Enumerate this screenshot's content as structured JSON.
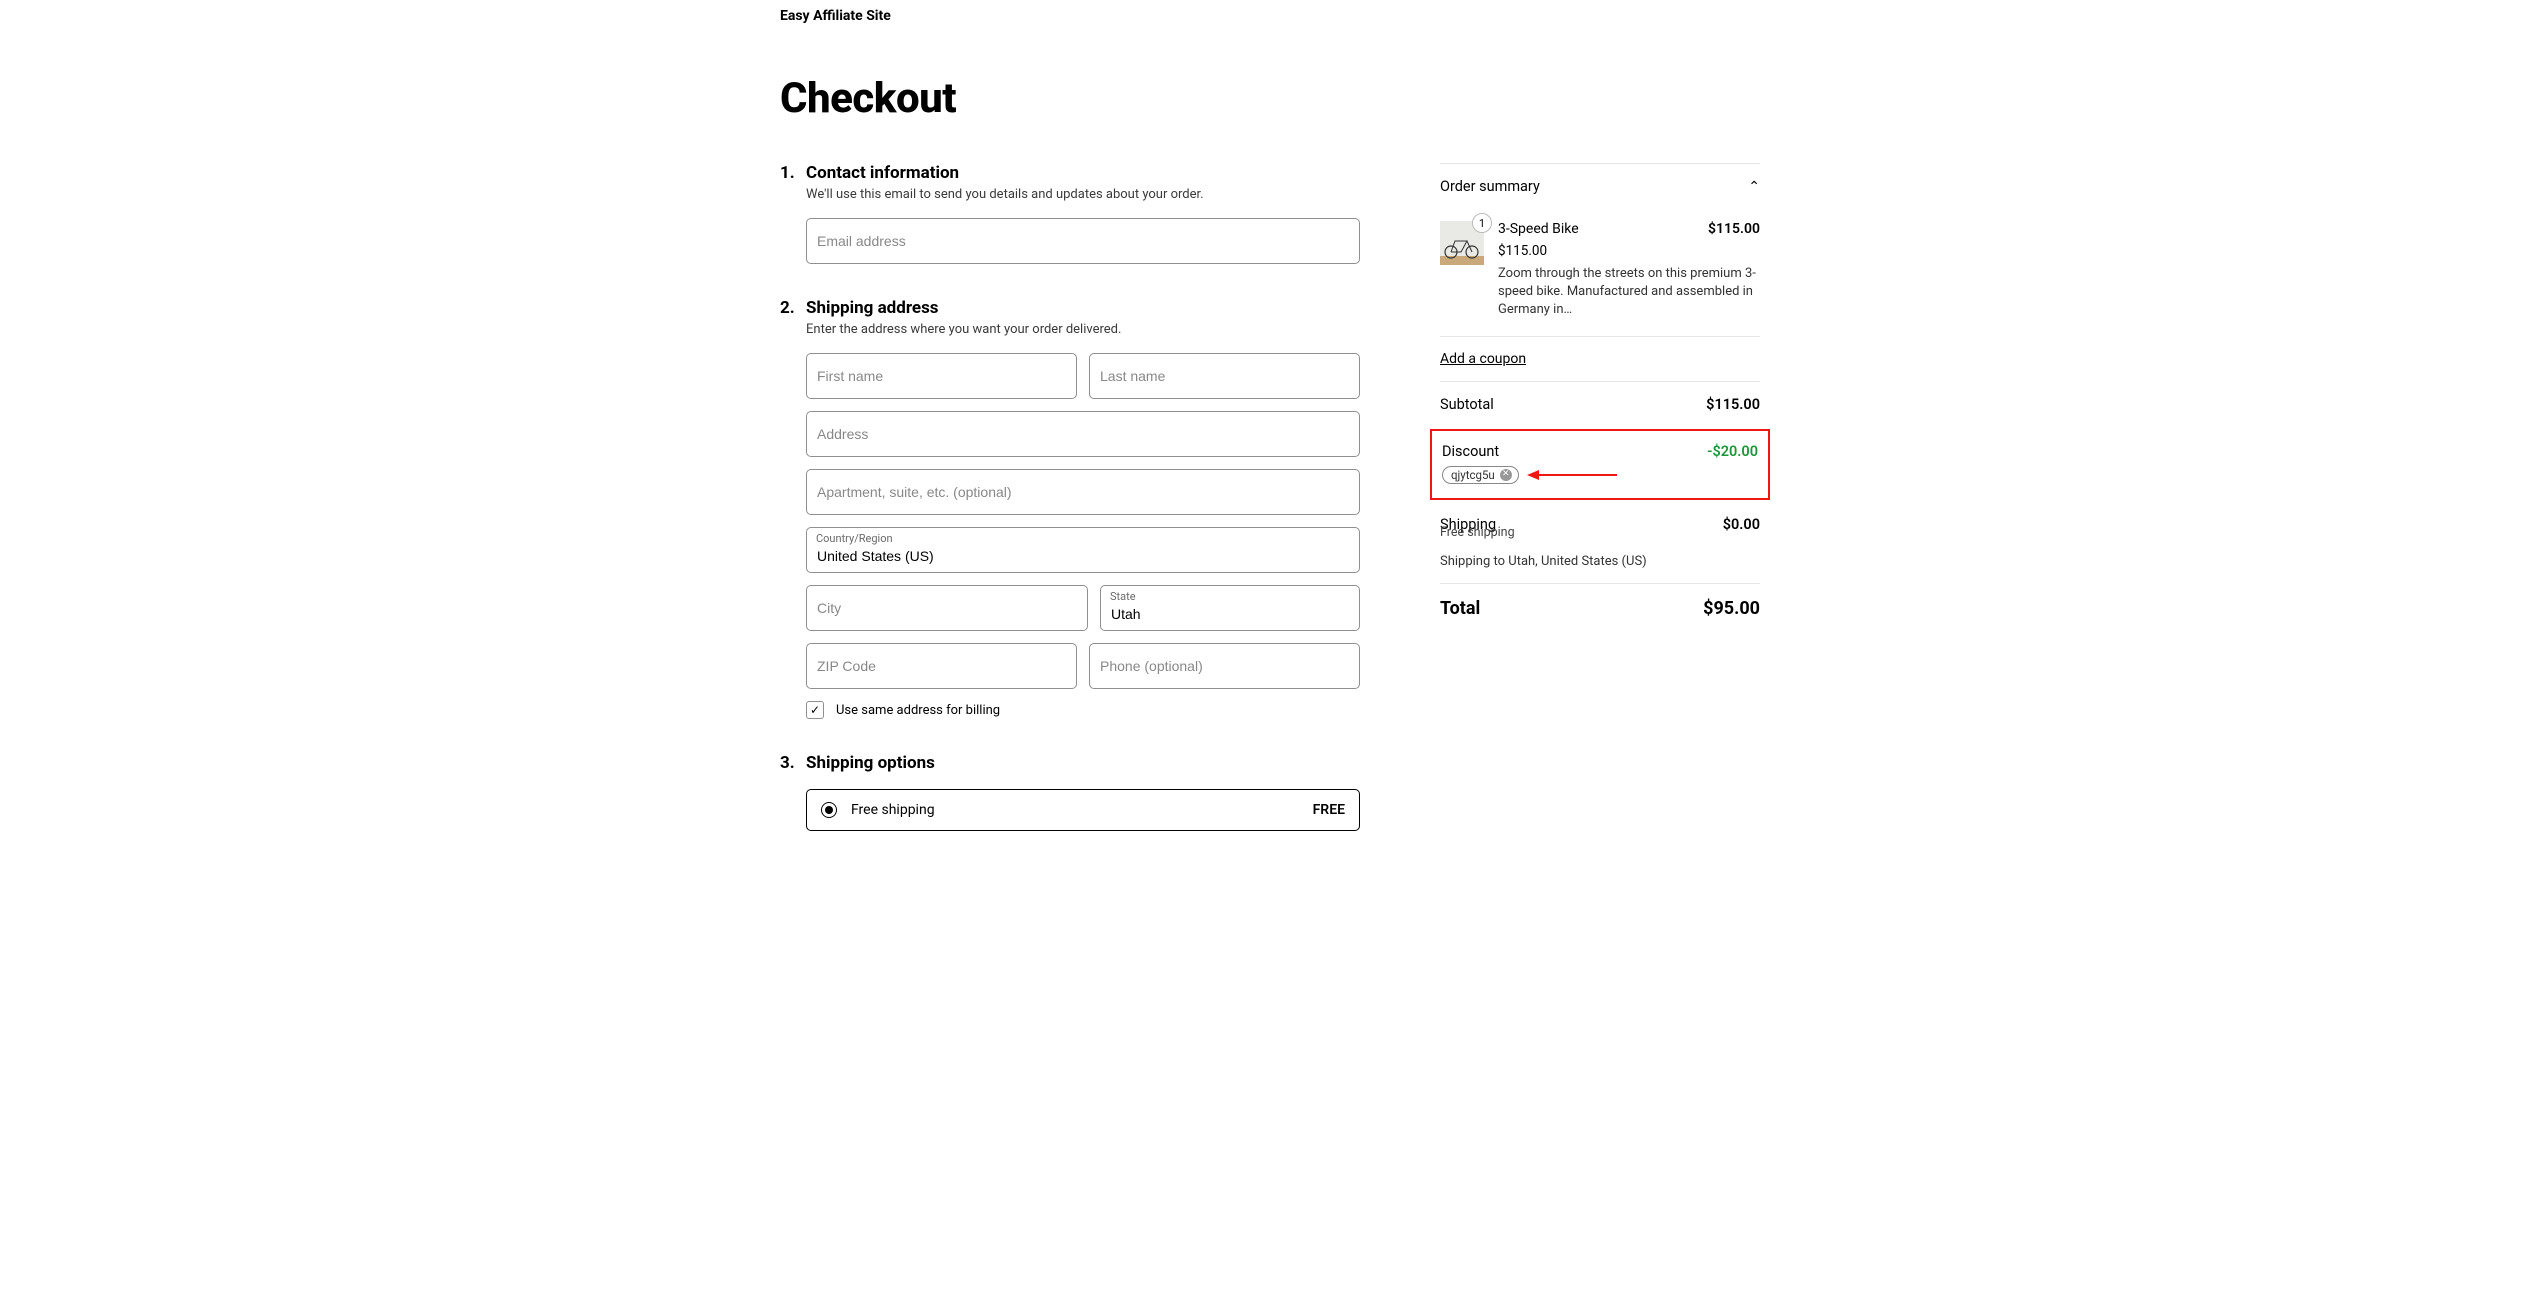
{
  "site_title": "Easy Affiliate Site",
  "page_title": "Checkout",
  "contact": {
    "step": "1.",
    "heading": "Contact information",
    "help": "We'll use this email to send you details and updates about your order.",
    "email_placeholder": "Email address",
    "email_value": ""
  },
  "shipping": {
    "step": "2.",
    "heading": "Shipping address",
    "help": "Enter the address where you want your order delivered.",
    "first_name_placeholder": "First name",
    "first_name_value": "",
    "last_name_placeholder": "Last name",
    "last_name_value": "",
    "address_placeholder": "Address",
    "address_value": "",
    "apt_placeholder": "Apartment, suite, etc. (optional)",
    "apt_value": "",
    "country_label": "Country/Region",
    "country_value": "United States (US)",
    "city_placeholder": "City",
    "city_value": "",
    "state_label": "State",
    "state_value": "Utah",
    "zip_placeholder": "ZIP Code",
    "zip_value": "",
    "phone_placeholder": "Phone (optional)",
    "phone_value": "",
    "same_billing_label": "Use same address for billing",
    "same_billing_checked": true
  },
  "shipping_options": {
    "step": "3.",
    "heading": "Shipping options",
    "options": [
      {
        "label": "Free shipping",
        "price": "FREE",
        "selected": true
      }
    ]
  },
  "summary": {
    "title": "Order summary",
    "product": {
      "qty": "1",
      "name": "3-Speed Bike",
      "line_price": "$115.00",
      "unit_price": "$115.00",
      "description": "Zoom through the streets on this premium 3-speed bike. Manufactured and assembled in Germany in…"
    },
    "add_coupon": "Add a coupon",
    "subtotal_label": "Subtotal",
    "subtotal_value": "$115.00",
    "discount_label": "Discount",
    "discount_value": "-$20.00",
    "coupon_code": "qjytcg5u",
    "shipping_label": "Shipping",
    "shipping_value": "$0.00",
    "shipping_method": "Free shipping",
    "shipping_dest": "Shipping to Utah, United States (US)",
    "total_label": "Total",
    "total_value": "$95.00"
  }
}
